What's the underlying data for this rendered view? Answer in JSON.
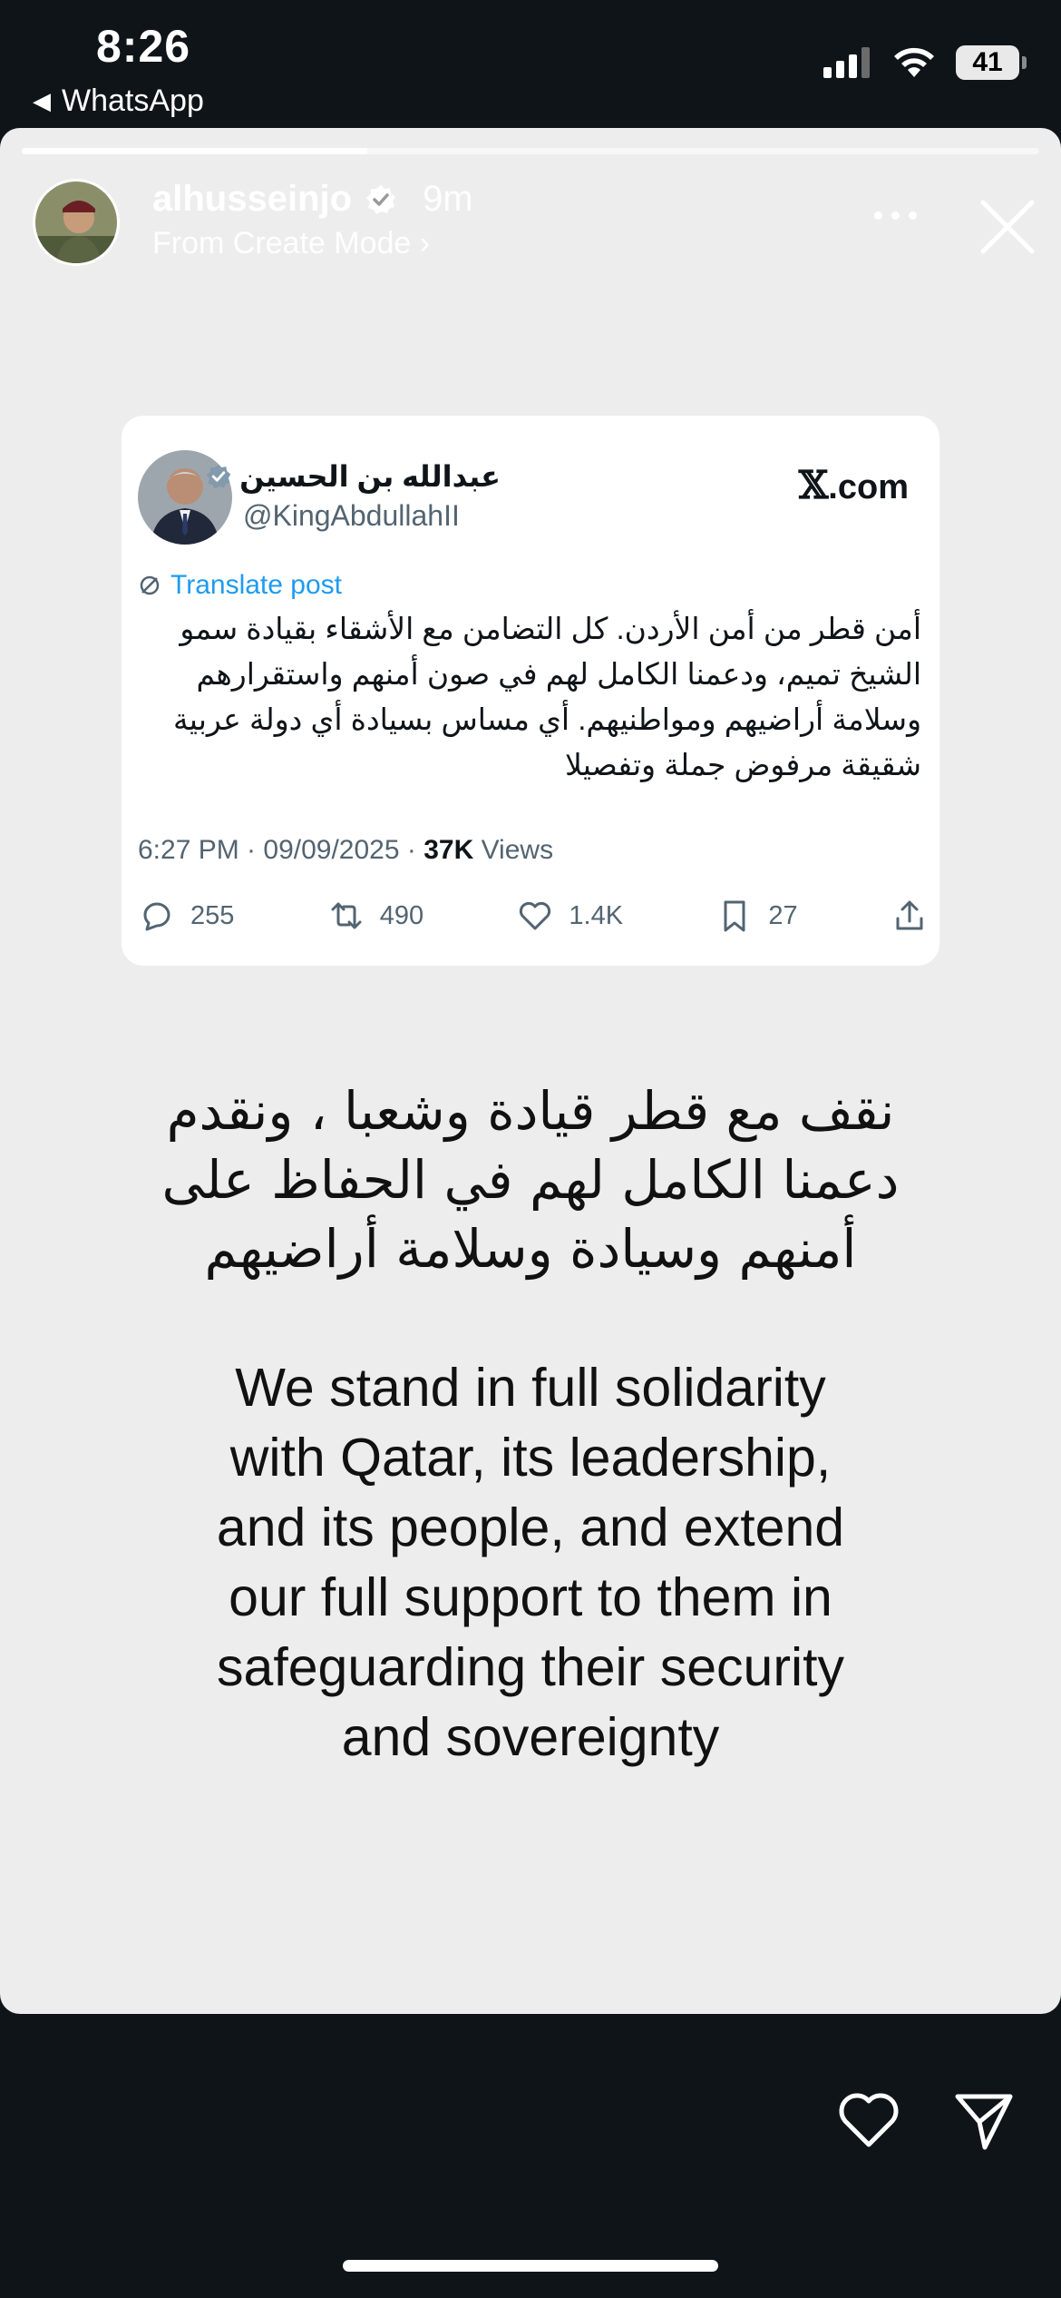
{
  "status_bar": {
    "time": "8:26",
    "back_app": "WhatsApp",
    "battery": "41"
  },
  "story": {
    "progress": 0.34,
    "username": "alhusseinjo",
    "time_ago": "9m",
    "subtitle": "From Create Mode ›",
    "arabic_text": "نقف مع قطر قيادة وشعبا ، ونقدم\nدعمنا الكامل لهم في الحفاظ على\nأمنهم وسيادة وسلامة أراضيهم",
    "english_text": "We stand in full solidarity\nwith Qatar, its leadership,\nand its people, and extend\nour full support to them in\nsafeguarding their security\nand sovereignty"
  },
  "tweet": {
    "display_name": "عبدالله بن الحسين",
    "handle": "@KingAbdullahII",
    "source": "X.com",
    "source_x": "𝕏",
    "source_rest": ".com",
    "translate": "Translate post",
    "body": "أمن قطر من أمن الأردن. كل التضامن مع الأشقاء بقيادة سمو الشيخ تميم، ودعمنا الكامل لهم في صون أمنهم واستقرارهم وسلامة أراضيهم ومواطنيهم. أي مساس بسيادة أي دولة عربية شقيقة مرفوض جملة وتفصيلا",
    "meta_time": "6:27 PM · 09/09/2025 · ",
    "views_count": "37K",
    "views_label": " Views",
    "replies": "255",
    "reposts": "490",
    "likes": "1.4K",
    "bookmarks": "27"
  },
  "colors": {
    "background": "#0f1419",
    "story_bg": "#ededed",
    "link_blue": "#1d9bf0"
  },
  "icons": [
    "signal-icon",
    "wifi-icon",
    "verified-icon",
    "more-icon",
    "close-icon",
    "reply-icon",
    "repost-icon",
    "like-icon",
    "bookmark-icon",
    "share-icon",
    "heart-icon",
    "send-icon"
  ]
}
